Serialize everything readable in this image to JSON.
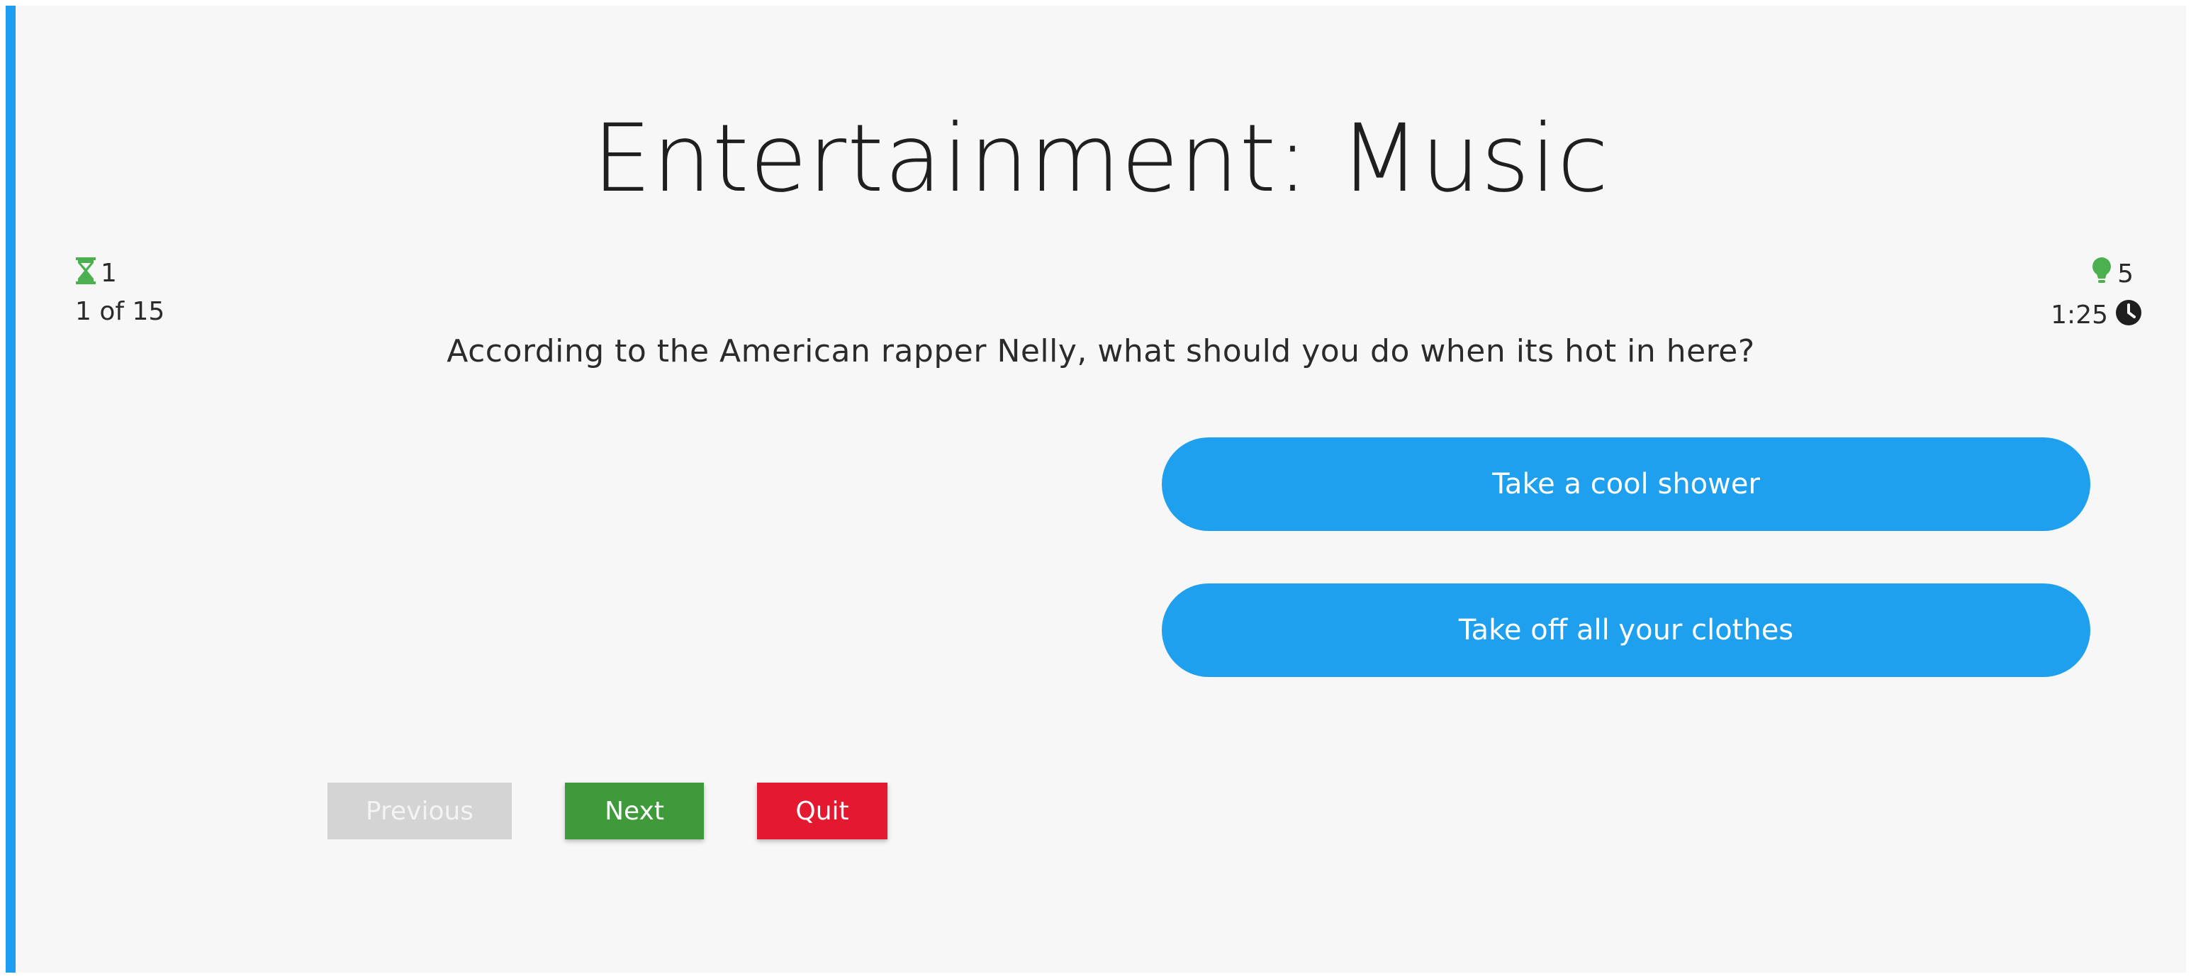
{
  "quiz": {
    "category": "Entertainment: Music",
    "hints_remaining": "1",
    "progress": "1 of 15",
    "fifty_fifty_remaining": "5",
    "timer": "1:25",
    "question": "According to the American rapper Nelly, what should you do when its hot in here?",
    "options": [
      {
        "label": "Take a cool shower"
      },
      {
        "label": "Take off all your clothes"
      }
    ]
  },
  "controls": {
    "previous_label": "Previous",
    "next_label": "Next",
    "quit_label": "Quit"
  },
  "icons": {
    "hints": "hourglass-icon",
    "fifty_fifty": "lightbulb-icon",
    "timer": "clock-icon"
  },
  "colors": {
    "accent": "#1ea0ef",
    "next": "#3f9b3a",
    "quit": "#e4182f",
    "previous_disabled": "#d4d4d4",
    "icon_green": "#4caf50"
  }
}
